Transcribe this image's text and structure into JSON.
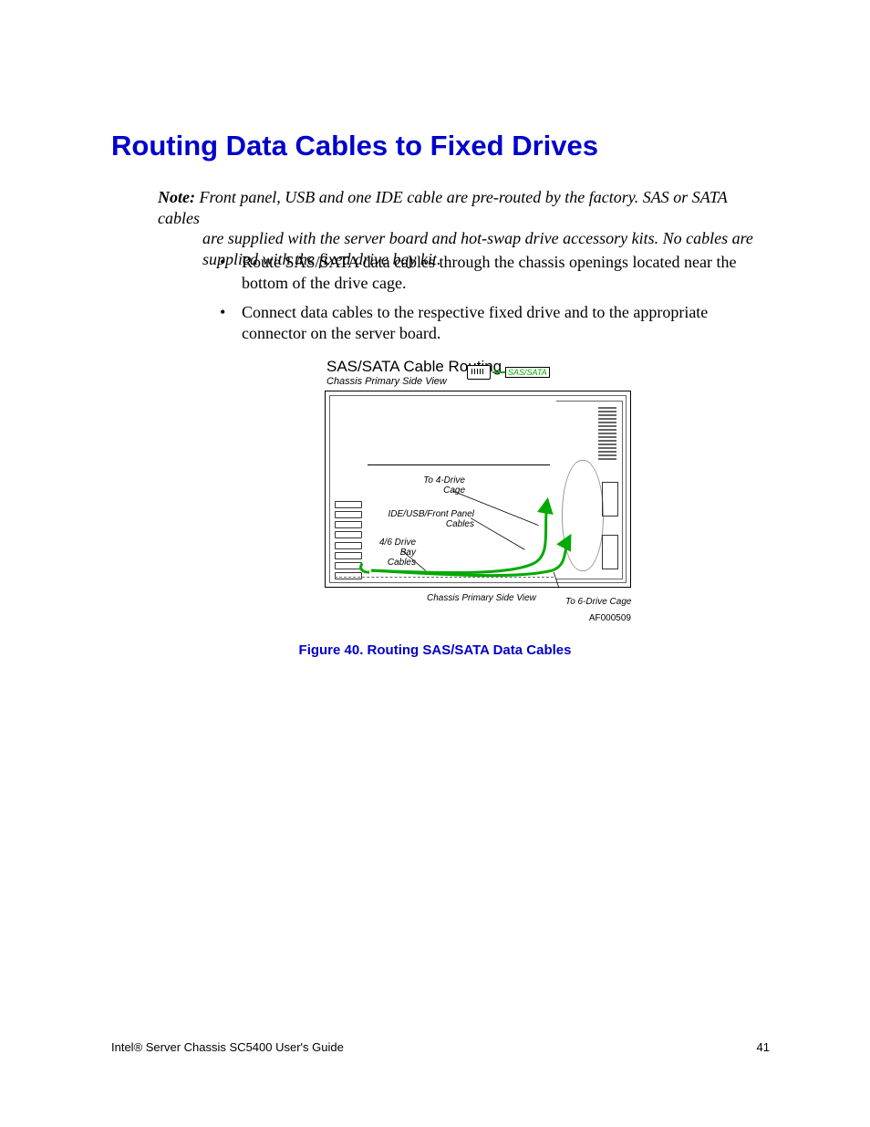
{
  "heading": "Routing Data Cables to Fixed Drives",
  "note": {
    "label": "Note:",
    "line1": "Front panel, USB and one IDE cable are pre-routed by the factory. SAS or SATA cables",
    "line2": "are supplied with the server board and hot-swap drive accessory kits. No cables are",
    "line3": "supplied with the fixed drive bay kit."
  },
  "bullets": [
    "Route SAS/SATA data cables through the chassis openings located near the bottom of the drive cage.",
    "Connect data cables to the respective fixed drive and to the appropriate connector on the server board."
  ],
  "figure": {
    "title": "SAS/SATA Cable Routing",
    "subtitle": "Chassis Primary Side View",
    "legend_label": "SAS/SATA",
    "lbl_to4": "To 4-Drive Cage",
    "lbl_ideusb": "IDE/USB/Front Panel Cables",
    "lbl_46drive": "4/6 Drive Bay Cables",
    "lbl_chassis2": "Chassis Primary Side View",
    "lbl_to6": "To 6-Drive Cage",
    "af": "AF000509",
    "caption": "Figure 40. Routing SAS/SATA Data Cables"
  },
  "footer": {
    "left": "Intel® Server Chassis SC5400 User's Guide",
    "right": "41"
  }
}
